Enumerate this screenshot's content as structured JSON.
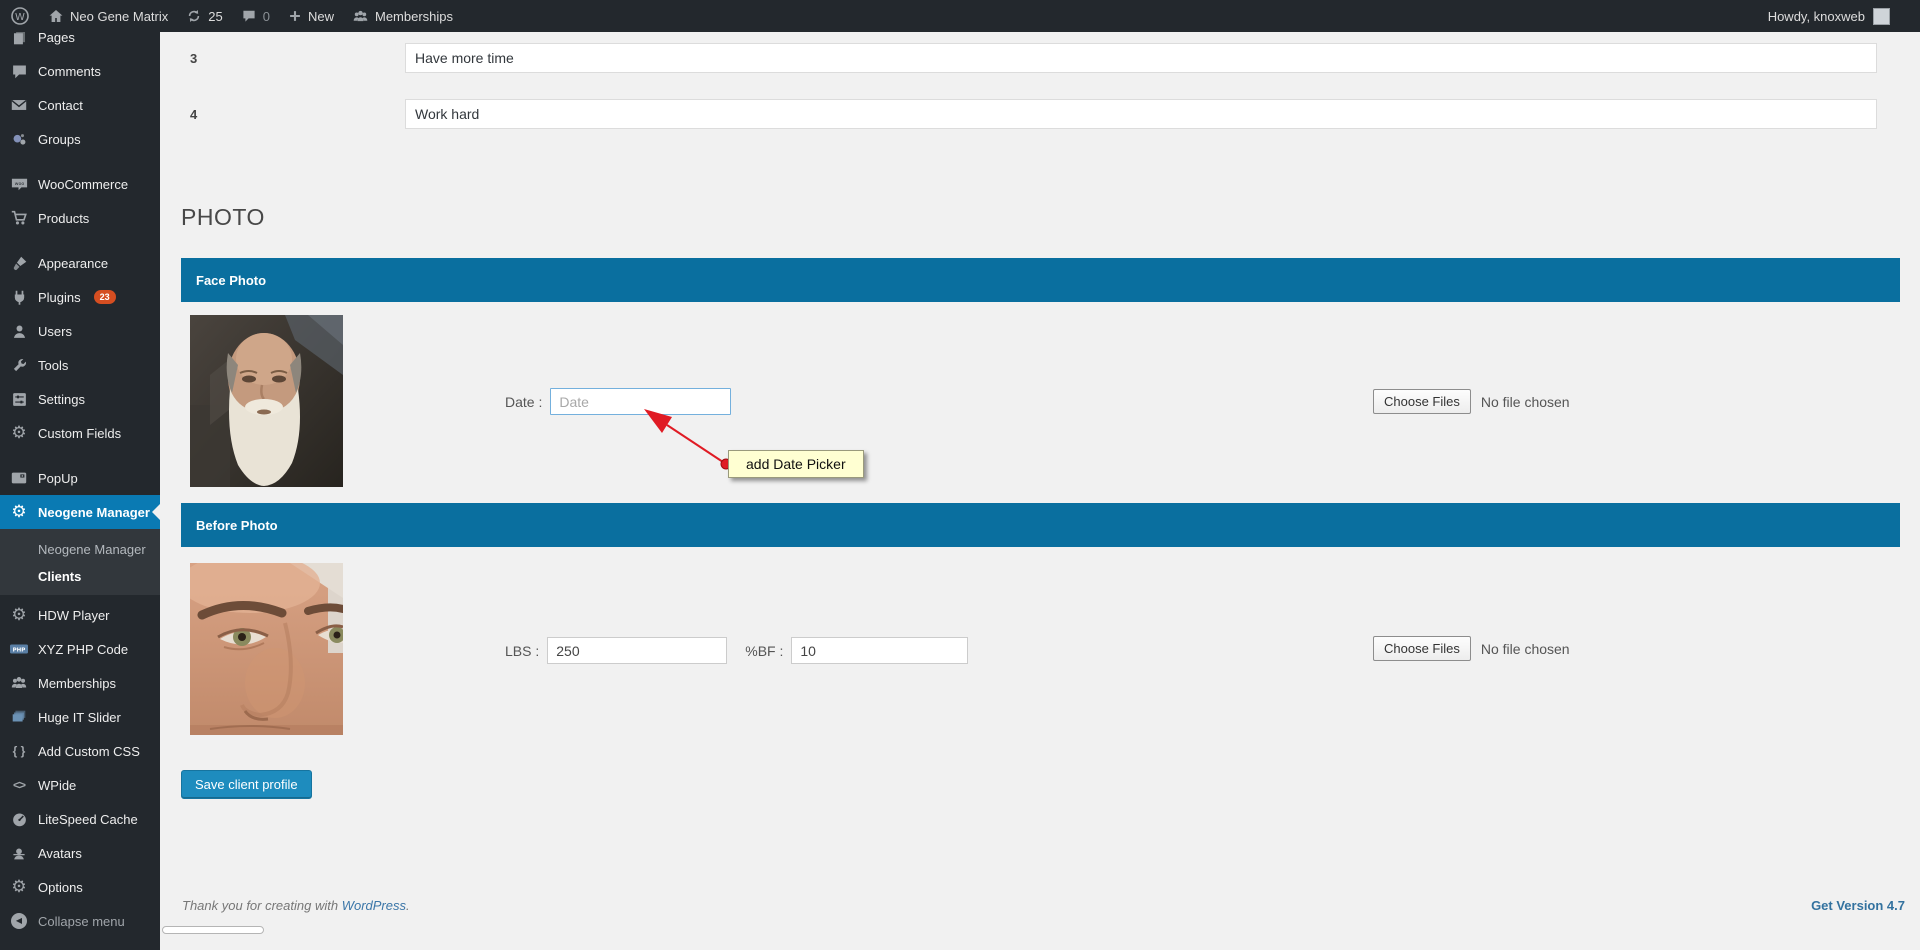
{
  "admin_bar": {
    "site_name": "Neo Gene Matrix",
    "update_count": "25",
    "comment_count": "0",
    "new_label": "New",
    "memberships_label": "Memberships",
    "howdy": "Howdy, knoxweb"
  },
  "sidebar": {
    "items": [
      {
        "label": "Pages"
      },
      {
        "label": "Comments"
      },
      {
        "label": "Contact"
      },
      {
        "label": "Groups"
      },
      {
        "label": "WooCommerce"
      },
      {
        "label": "Products"
      },
      {
        "label": "Appearance"
      },
      {
        "label": "Plugins",
        "badge": "23"
      },
      {
        "label": "Users"
      },
      {
        "label": "Tools"
      },
      {
        "label": "Settings"
      },
      {
        "label": "Custom Fields"
      },
      {
        "label": "PopUp"
      },
      {
        "label": "Neogene Manager"
      },
      {
        "label": "HDW Player"
      },
      {
        "label": "XYZ PHP Code"
      },
      {
        "label": "Memberships"
      },
      {
        "label": "Huge IT Slider"
      },
      {
        "label": "Add Custom CSS"
      },
      {
        "label": "WPide"
      },
      {
        "label": "LiteSpeed Cache"
      },
      {
        "label": "Avatars"
      },
      {
        "label": "Options"
      }
    ],
    "submenu": {
      "parent": "Neogene Manager",
      "current": "Clients"
    },
    "collapse_label": "Collapse menu"
  },
  "form_rows": [
    {
      "num": "3",
      "value": "Have more time"
    },
    {
      "num": "4",
      "value": "Work hard"
    }
  ],
  "photo": {
    "heading": "PHOTO",
    "face_header": "Face Photo",
    "date_label": "Date :",
    "date_placeholder": "Date",
    "tooltip": "add Date Picker",
    "before_header": "Before Photo",
    "lbs_label": "LBS :",
    "lbs_value": "250",
    "bf_label": "%BF :",
    "bf_value": "10",
    "choose_files": "Choose Files",
    "no_file": "No file chosen"
  },
  "save_label": "Save client profile",
  "footer": {
    "thanks": "Thank you for creating with",
    "link": "WordPress",
    "suffix": ".",
    "version": "Get Version 4.7"
  },
  "colors": {
    "admin_bar_bg": "#23282d",
    "submenu_bg": "#32373c",
    "active_menu": "#0a7ab3",
    "section_bar": "#0a6f9f",
    "plugin_badge": "#d54e21",
    "save_button": "#1e8cbe",
    "annotation_red": "#e01b24",
    "tooltip_bg": "#ffffd2",
    "content_bg": "#f1f1f1"
  }
}
